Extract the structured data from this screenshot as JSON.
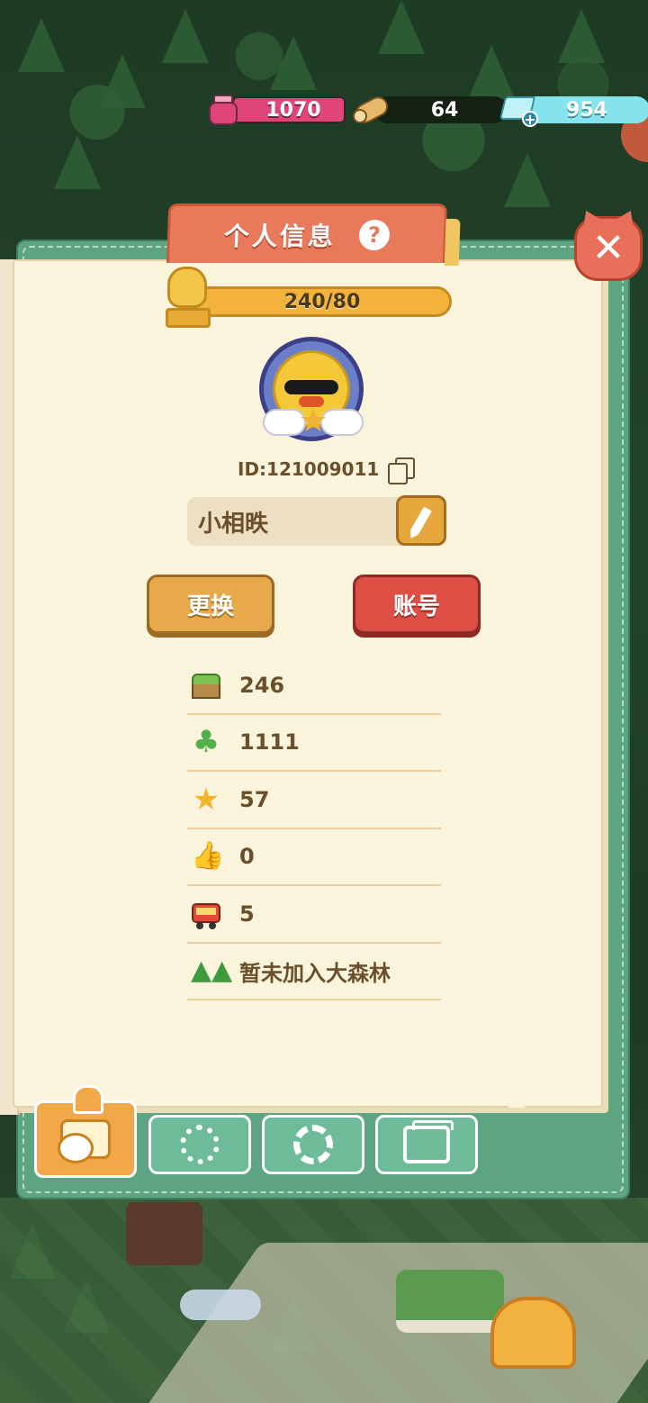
{
  "resources": {
    "ink": {
      "icon": "ink-bottle-icon",
      "value": "1070"
    },
    "wood": {
      "icon": "wood-log-icon",
      "value": "64"
    },
    "gem": {
      "icon": "diamond-plus-icon",
      "value": "954"
    }
  },
  "panel": {
    "title": "个人信息",
    "help_icon": "?",
    "close_icon": "✕"
  },
  "profile": {
    "level_progress": "240/80",
    "id_text": "ID:121009011",
    "nickname": "小相昳",
    "buttons": {
      "change": "更换",
      "account": "账号"
    }
  },
  "stats": [
    {
      "icon": "grass-block-icon",
      "value": "246"
    },
    {
      "icon": "clover-icon",
      "value": "1111"
    },
    {
      "icon": "star-icon",
      "value": "57"
    },
    {
      "icon": "thumbs-up-icon",
      "value": "0"
    },
    {
      "icon": "bus-icon",
      "value": "5"
    },
    {
      "icon": "forest-icon",
      "value": "暂未加入大森林"
    }
  ],
  "tabs": [
    {
      "icon": "profile-card-icon",
      "active": true
    },
    {
      "icon": "badge-icon",
      "active": false
    },
    {
      "icon": "gear-icon",
      "active": false
    },
    {
      "icon": "photo-album-icon",
      "active": false
    }
  ],
  "colors": {
    "panel_green": "#5da482",
    "page_cream": "#fbf4dc",
    "title_red": "#e8795a",
    "level_orange": "#f2b23c",
    "change_button": "#e8a94a",
    "account_button": "#dd4f44",
    "text_brown": "#6b4f2a"
  }
}
